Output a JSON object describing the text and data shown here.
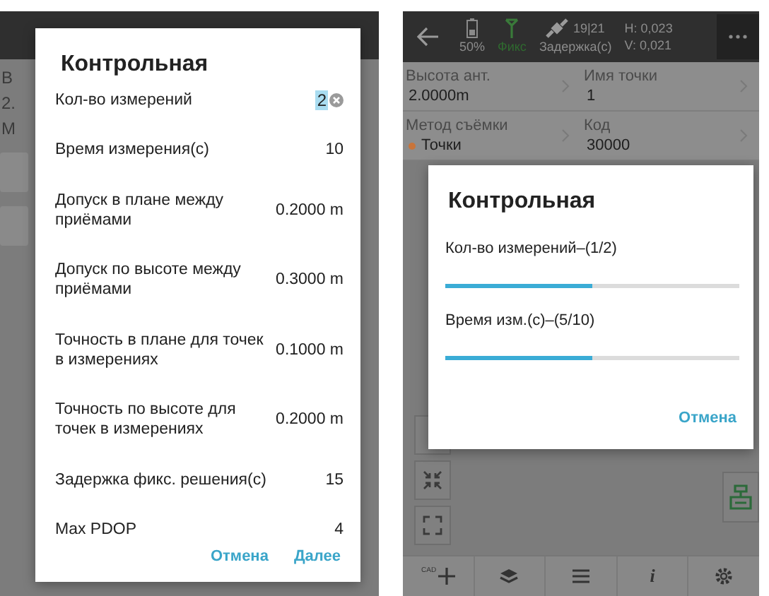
{
  "left_screen": {
    "background_fragments": [
      "В",
      "2.",
      "М"
    ],
    "dialog": {
      "title": "Контрольная",
      "fields": [
        {
          "kind": "input",
          "label": "Кол-во измерений",
          "value": "2"
        },
        {
          "kind": "text",
          "label": "Время измерения(c)",
          "value": "10"
        },
        {
          "kind": "text",
          "label": "Допуск в плане между приёмами",
          "value": "0.2000 m"
        },
        {
          "kind": "text",
          "label": "Допуск по высоте между приёмами",
          "value": "0.3000 m"
        },
        {
          "kind": "text",
          "label": "Точность в плане для точек в измерениях",
          "value": "0.1000 m"
        },
        {
          "kind": "text",
          "label": "Точность по высоте для точек в измерениях",
          "value": "0.2000 m"
        },
        {
          "kind": "text",
          "label": "Задержка фикс. решения(c)",
          "value": "15"
        },
        {
          "kind": "text",
          "label": "Max PDOP",
          "value": "4"
        }
      ],
      "buttons": [
        "Отмена",
        "Далее"
      ]
    }
  },
  "right_screen": {
    "status_bar": {
      "battery": "50%",
      "fix": "Фикс",
      "satellites": "19|21",
      "delay": "Задержка(c)",
      "h": "H: 0,023",
      "v": "V: 0,021"
    },
    "info": [
      {
        "label": "Высота ант.",
        "value": "2.0000m"
      },
      {
        "label": "Имя точки",
        "value": "1"
      },
      {
        "label": "Метод съёмки",
        "value": "Точки",
        "color": "#c8743a"
      },
      {
        "label": "Код",
        "value": "30000"
      }
    ],
    "dialog": {
      "title": "Контрольная",
      "progress": [
        {
          "label": "Кол-во измерений–(1/2)",
          "level": 0.5
        },
        {
          "label": "Время изм.(c)–(5/10)",
          "level": 0.5
        }
      ],
      "buttons": [
        "Отмена"
      ]
    },
    "toolbar": [
      {
        "kind": "cad",
        "label": "CAD"
      },
      {
        "kind": "layers"
      },
      {
        "kind": "list"
      },
      {
        "kind": "info",
        "label": "i"
      },
      {
        "kind": "settings"
      }
    ]
  }
}
